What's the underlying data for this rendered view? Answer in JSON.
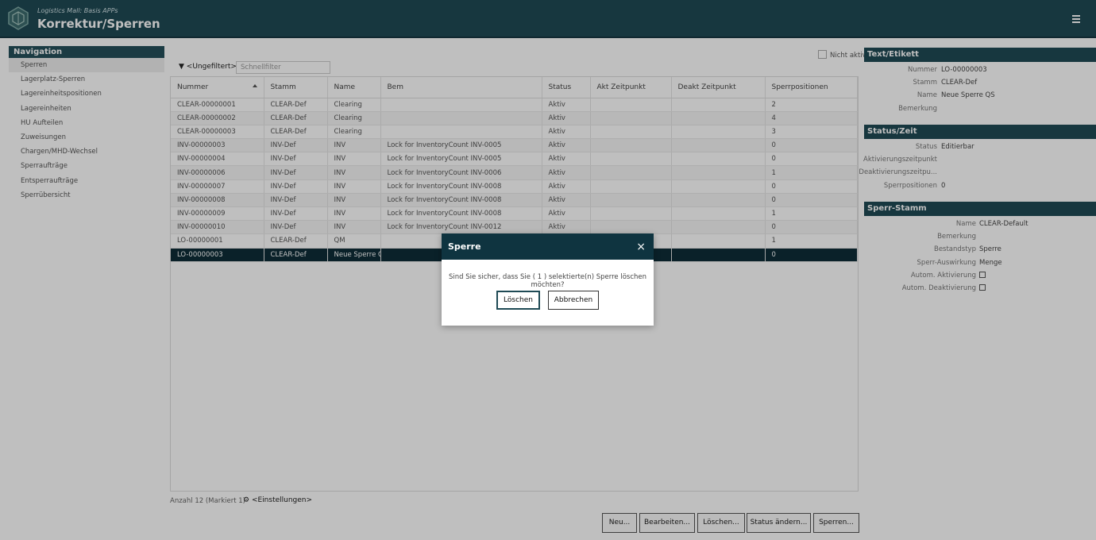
{
  "header": {
    "subtitle": "Logistics Mall: Basis APPs",
    "title": "Korrektur/Sperren",
    "menu_icon": "hamburger-menu-icon",
    "logo_icon": "hexagon-logo-icon"
  },
  "nav": {
    "heading": "Navigation",
    "items": [
      "Sperren",
      "Lagerplatz-Sperren",
      "Lagereinheitspositionen",
      "Lagereinheiten",
      "HU Aufteilen",
      "Zuweisungen",
      "Chargen/MHD-Wechsel",
      "Sperraufträge",
      "Entsperraufträge",
      "Sperrübersicht"
    ]
  },
  "toolbar": {
    "filter_label": "<Ungefiltert>",
    "quick_filter_placeholder": "Schnellfilter",
    "nicht_aktiv": "Nicht aktiv"
  },
  "grid": {
    "columns": [
      "Nummer",
      "Stamm",
      "Name",
      "Bem",
      "Status",
      "Akt Zeitpunkt",
      "Deakt Zeitpunkt",
      "Sperrpositionen"
    ],
    "rows": [
      [
        "CLEAR-00000001",
        "CLEAR-Def",
        "Clearing",
        "",
        "Aktiv",
        "",
        "",
        "2"
      ],
      [
        "CLEAR-00000002",
        "CLEAR-Def",
        "Clearing",
        "",
        "Aktiv",
        "",
        "",
        "4"
      ],
      [
        "CLEAR-00000003",
        "CLEAR-Def",
        "Clearing",
        "",
        "Aktiv",
        "",
        "",
        "3"
      ],
      [
        "INV-00000003",
        "INV-Def",
        "INV",
        "Lock for InventoryCount INV-0005",
        "Aktiv",
        "",
        "",
        "0"
      ],
      [
        "INV-00000004",
        "INV-Def",
        "INV",
        "Lock for InventoryCount INV-0005",
        "Aktiv",
        "",
        "",
        "0"
      ],
      [
        "INV-00000006",
        "INV-Def",
        "INV",
        "Lock for InventoryCount INV-0006",
        "Aktiv",
        "",
        "",
        "1"
      ],
      [
        "INV-00000007",
        "INV-Def",
        "INV",
        "Lock for InventoryCount INV-0008",
        "Aktiv",
        "",
        "",
        "0"
      ],
      [
        "INV-00000008",
        "INV-Def",
        "INV",
        "Lock for InventoryCount INV-0008",
        "Aktiv",
        "",
        "",
        "0"
      ],
      [
        "INV-00000009",
        "INV-Def",
        "INV",
        "Lock for InventoryCount INV-0008",
        "Aktiv",
        "",
        "",
        "1"
      ],
      [
        "INV-00000010",
        "INV-Def",
        "INV",
        "Lock for InventoryCount INV-0012",
        "Aktiv",
        "",
        "",
        "0"
      ],
      [
        "LO-00000001",
        "CLEAR-Def",
        "QM",
        "",
        "",
        "",
        "",
        "1"
      ],
      [
        "LO-00000003",
        "CLEAR-Def",
        "Neue Sperre QS",
        "",
        "",
        "",
        "",
        "0"
      ]
    ],
    "selected_row": 11
  },
  "footer": {
    "count": "Anzahl 12 (Markiert 1)",
    "settings": "<Einstellungen>",
    "buttons": [
      "Neu...",
      "Bearbeiten...",
      "Löschen...",
      "Status ändern...",
      "Sperren..."
    ]
  },
  "panel_text": {
    "heading": "Text/Etikett",
    "props": [
      {
        "k": "Nummer",
        "v": "LO-00000003"
      },
      {
        "k": "Stamm",
        "v": "CLEAR-Def"
      },
      {
        "k": "Name",
        "v": "Neue Sperre QS"
      },
      {
        "k": "Bemerkung",
        "v": ""
      }
    ]
  },
  "panel_status": {
    "heading": "Status/Zeit",
    "props": [
      {
        "k": "Status",
        "v": "Editierbar"
      },
      {
        "k": "Aktivierungszeitpunkt",
        "v": ""
      },
      {
        "k": "Deaktivierungszeitpu...",
        "v": ""
      },
      {
        "k": "Sperrpositionen",
        "v": "0"
      }
    ]
  },
  "panel_stamm": {
    "heading": "Sperr-Stamm",
    "props": [
      {
        "k": "Name",
        "v": "CLEAR-Default"
      },
      {
        "k": "Bemerkung",
        "v": ""
      },
      {
        "k": "Bestandstyp",
        "v": "Sperre"
      },
      {
        "k": "Sperr-Auswirkung",
        "v": "Menge"
      },
      {
        "k": "Autom. Aktivierung",
        "v": ""
      },
      {
        "k": "Autom. Deaktivierung",
        "v": ""
      }
    ]
  },
  "dialog": {
    "title": "Sperre",
    "close": "×",
    "message": "Sind Sie sicher, dass Sie ( 1 ) selektierte(n) Sperre löschen möchten?",
    "confirm": "Löschen",
    "cancel": "Abbrechen"
  }
}
